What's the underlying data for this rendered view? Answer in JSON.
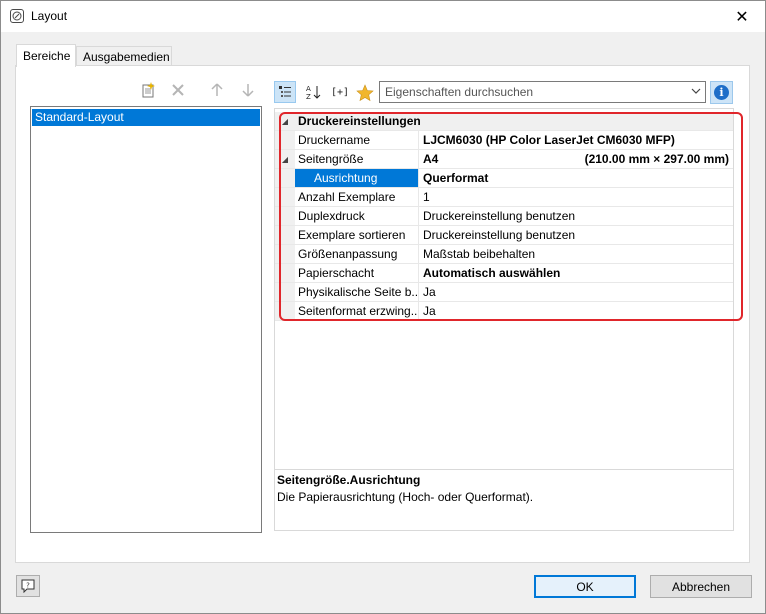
{
  "window": {
    "title": "Layout",
    "close_glyph": "✕"
  },
  "tabs": [
    {
      "label": "Bereiche",
      "active": true
    },
    {
      "label": "Ausgabemedien",
      "active": false
    }
  ],
  "left_toolbar": {
    "icons": [
      "new-item-icon",
      "delete-icon",
      "arrow-up-icon",
      "arrow-down-icon"
    ]
  },
  "layout_list": {
    "items": [
      "Standard-Layout"
    ],
    "selected": "Standard-Layout"
  },
  "property_toolbar": {
    "icons": [
      "categorized-view-icon",
      "alphabetic-sort-icon",
      "expand-all-icon",
      "favorite-star-icon"
    ],
    "expand_label": "[+]",
    "search_placeholder": "Eigenschaften durchsuchen"
  },
  "properties": {
    "category": "Druckereinstellungen",
    "rows": [
      {
        "name": "Druckername",
        "value": "LJCM6030 (HP Color LaserJet CM6030 MFP)"
      },
      {
        "name": "Seitengröße",
        "value": "A4",
        "value_extra": "(210.00 mm × 297.00 mm)"
      },
      {
        "name": "Ausrichtung",
        "value": "Querformat"
      },
      {
        "name": "Anzahl Exemplare",
        "value": "1"
      },
      {
        "name": "Duplexdruck",
        "value": "Druckereinstellung benutzen"
      },
      {
        "name": "Exemplare sortieren",
        "value": "Druckereinstellung benutzen"
      },
      {
        "name": "Größenanpassung",
        "value": "Maßstab beibehalten"
      },
      {
        "name": "Papierschacht",
        "value": "Automatisch auswählen"
      },
      {
        "name": "Physikalische Seite b...",
        "value": "Ja"
      },
      {
        "name": "Seitenformat erzwing...",
        "value": "Ja"
      }
    ]
  },
  "description": {
    "title": "Seitengröße.Ausrichtung",
    "text": "Die Papierausrichtung (Hoch- oder Querformat)."
  },
  "buttons": {
    "help": "?",
    "ok": "OK",
    "cancel": "Abbrechen"
  },
  "colors": {
    "selection": "#0078d7",
    "highlight_border": "#e0262b",
    "info_blue": "#1e6ec8"
  }
}
